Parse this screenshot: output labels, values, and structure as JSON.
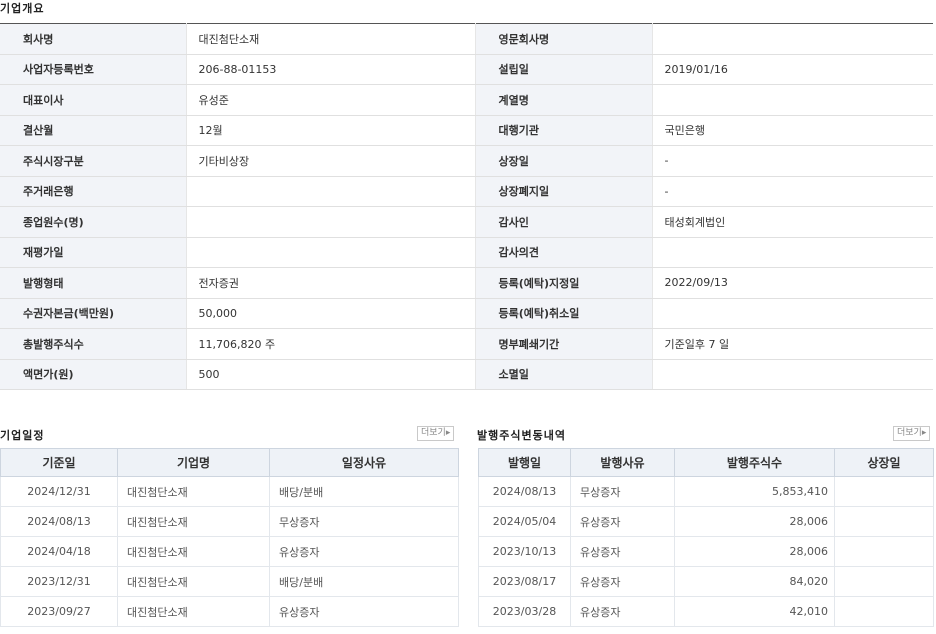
{
  "overview": {
    "title": "기업개요",
    "rows": [
      {
        "l1": "회사명",
        "v1": "대진첨단소재",
        "l2": "영문회사명",
        "v2": ""
      },
      {
        "l1": "사업자등록번호",
        "v1": "206-88-01153",
        "l2": "설립일",
        "v2": "2019/01/16"
      },
      {
        "l1": "대표이사",
        "v1": "유성준",
        "l2": "계열명",
        "v2": ""
      },
      {
        "l1": "결산월",
        "v1": "12월",
        "l2": "대행기관",
        "v2": "국민은행"
      },
      {
        "l1": "주식시장구분",
        "v1": "기타비상장",
        "l2": "상장일",
        "v2": "-"
      },
      {
        "l1": "주거래은행",
        "v1": "",
        "l2": "상장폐지일",
        "v2": "-"
      },
      {
        "l1": "종업원수(명)",
        "v1": "",
        "l2": "감사인",
        "v2": "태성회계법인"
      },
      {
        "l1": "재평가일",
        "v1": "",
        "l2": "감사의견",
        "v2": ""
      },
      {
        "l1": "발행형태",
        "v1": "전자증권",
        "l2": "등록(예탁)지정일",
        "v2": "2022/09/13"
      },
      {
        "l1": "수권자본금(백만원)",
        "v1": "50,000",
        "l2": "등록(예탁)취소일",
        "v2": ""
      },
      {
        "l1": "총발행주식수",
        "v1": "11,706,820 주",
        "l2": "명부폐쇄기간",
        "v2": "기준일후 7 일"
      },
      {
        "l1": "액면가(원)",
        "v1": "500",
        "l2": "소멸일",
        "v2": ""
      }
    ]
  },
  "schedule": {
    "title": "기업일정",
    "more_label": "더보기▸",
    "headers": [
      "기준일",
      "기업명",
      "일정사유"
    ],
    "rows": [
      [
        "2024/12/31",
        "대진첨단소재",
        "배당/분배"
      ],
      [
        "2024/08/13",
        "대진첨단소재",
        "무상증자"
      ],
      [
        "2024/04/18",
        "대진첨단소재",
        "유상증자"
      ],
      [
        "2023/12/31",
        "대진첨단소재",
        "배당/분배"
      ],
      [
        "2023/09/27",
        "대진첨단소재",
        "유상증자"
      ]
    ]
  },
  "shares": {
    "title": "발행주식변동내역",
    "more_label": "더보기▸",
    "headers": [
      "발행일",
      "발행사유",
      "발행주식수",
      "상장일"
    ],
    "rows": [
      [
        "2024/08/13",
        "무상증자",
        "5,853,410",
        ""
      ],
      [
        "2024/05/04",
        "유상증자",
        "28,006",
        ""
      ],
      [
        "2023/10/13",
        "유상증자",
        "28,006",
        ""
      ],
      [
        "2023/08/17",
        "유상증자",
        "84,020",
        ""
      ],
      [
        "2023/03/28",
        "유상증자",
        "42,010",
        ""
      ]
    ]
  }
}
